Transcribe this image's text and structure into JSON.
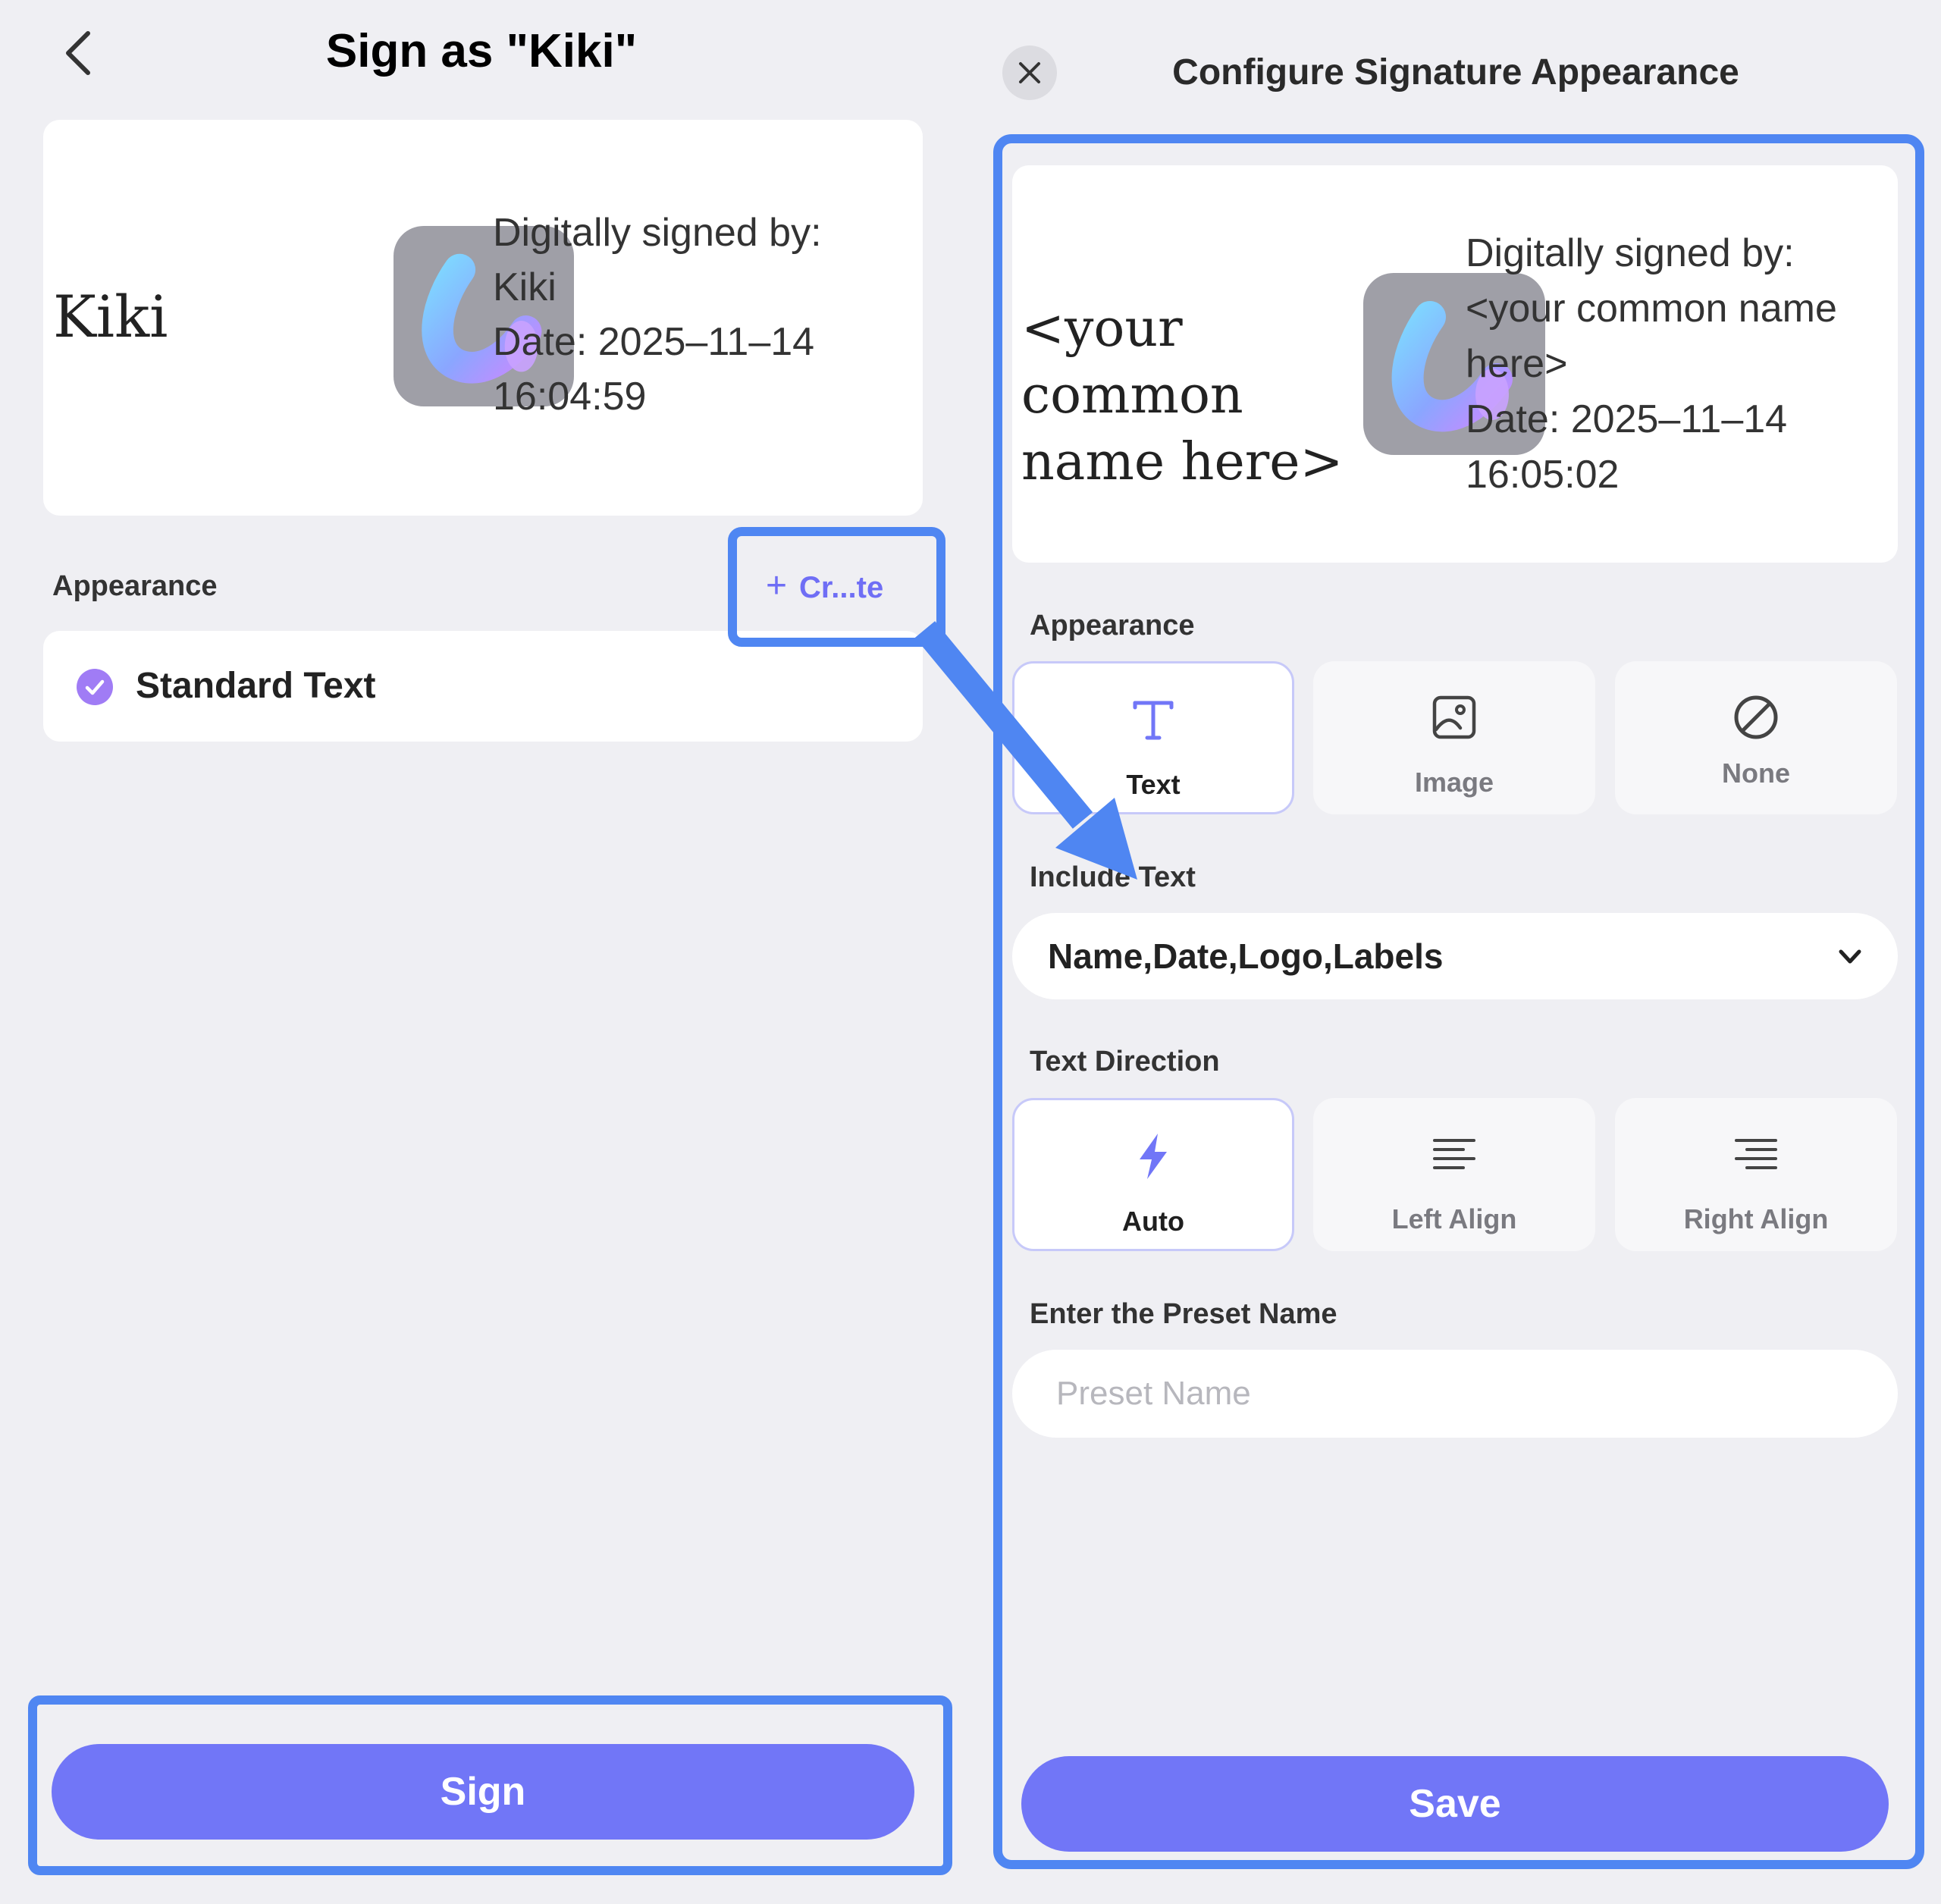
{
  "left_panel": {
    "title": "Sign as \"Kiki\"",
    "preview": {
      "name": "Kiki",
      "info_lines": [
        "Digitally signed by:",
        "Kiki",
        "Date: 2025–11–14",
        "16:04:59"
      ]
    },
    "appearance_label": "Appearance",
    "create_button": {
      "plus": "+",
      "label": "Cr...te"
    },
    "appearance_items": [
      {
        "label": "Standard Text",
        "selected": true
      }
    ],
    "sign_button": "Sign"
  },
  "right_panel": {
    "title": "Configure Signature Appearance",
    "preview": {
      "name_lines": [
        "<your common",
        "name here>"
      ],
      "info_lines": [
        "Digitally signed by:",
        "<your common name",
        "here>",
        "Date: 2025–11–14",
        "16:05:02"
      ]
    },
    "appearance": {
      "label": "Appearance",
      "options": [
        {
          "label": "Text",
          "icon": "text-t-icon",
          "selected": true
        },
        {
          "label": "Image",
          "icon": "image-icon",
          "selected": false
        },
        {
          "label": "None",
          "icon": "none-slash-icon",
          "selected": false
        }
      ]
    },
    "include_text": {
      "label": "Include Text",
      "value": "Name,Date,Logo,Labels"
    },
    "text_direction": {
      "label": "Text Direction",
      "options": [
        {
          "label": "Auto",
          "icon": "lightning-icon",
          "selected": true
        },
        {
          "label": "Left Align",
          "icon": "align-left-icon",
          "selected": false
        },
        {
          "label": "Right Align",
          "icon": "align-right-icon",
          "selected": false
        }
      ]
    },
    "preset": {
      "label": "Enter the Preset Name",
      "placeholder": "Preset Name",
      "value": ""
    },
    "save_button": "Save"
  },
  "colors": {
    "accent": "#7176f7",
    "highlight": "#4f86f2",
    "background": "#efeff3"
  }
}
